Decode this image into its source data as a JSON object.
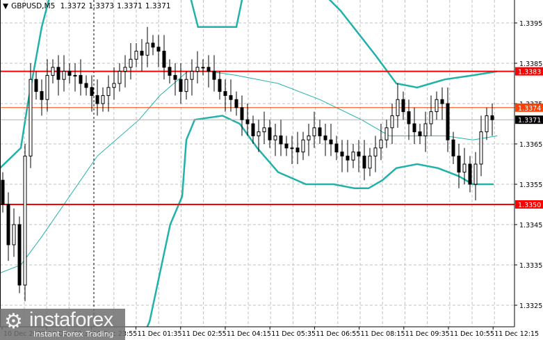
{
  "header": {
    "symbol": "GBPUSD,M5",
    "open": "1.3372",
    "high": "1.3373",
    "low": "1.3371",
    "close": "1.3371",
    "menu_icon": "triangle-down-icon"
  },
  "logo": {
    "brand": "instaforex",
    "tagline": "Instant Forex Trading"
  },
  "colors": {
    "level": "#ff0000",
    "bid": "#ff4000",
    "current": "#000000",
    "band": "#20b2aa",
    "grid": "#c0c0c0"
  },
  "chart_data": {
    "type": "candlestick",
    "title": "GBPUSD,M5",
    "ylim": [
      1.33164,
      1.33957
    ],
    "y_ticks": [
      "1.3395",
      "1.3385",
      "1.3375",
      "1.3365",
      "1.3355",
      "1.3345",
      "1.3335",
      "1.3325"
    ],
    "x_ticks": [
      "10 Dec 2025",
      "10 Dec 22:35",
      "10 Dec 23:55",
      "11 Dec 01:35",
      "11 Dec 02:55",
      "11 Dec 04:15",
      "11 Dec 05:35",
      "11 Dec 06:55",
      "11 Dec 08:15",
      "11 Dec 09:35",
      "11 Dec 10:55",
      "11 Dec 12:15"
    ],
    "closes": [
      1.335,
      1.334,
      1.3345,
      1.333,
      1.3362,
      1.3381,
      1.3378,
      1.3376,
      1.3382,
      1.3384,
      1.3381,
      1.3383,
      1.3382,
      1.3382,
      1.338,
      1.3379,
      1.3377,
      1.3375,
      1.3377,
      1.3379,
      1.338,
      1.3383,
      1.3384,
      1.3386,
      1.3388,
      1.3387,
      1.339,
      1.3389,
      1.3388,
      1.3384,
      1.3382,
      1.3381,
      1.3378,
      1.3381,
      1.3383,
      1.3384,
      1.3384,
      1.3383,
      1.3381,
      1.3378,
      1.3377,
      1.3376,
      1.3374,
      1.3371,
      1.337,
      1.3367,
      1.3368,
      1.3369,
      1.3366,
      1.3367,
      1.3365,
      1.3364,
      1.3364,
      1.3363,
      1.3366,
      1.3367,
      1.3369,
      1.3367,
      1.3366,
      1.3365,
      1.3363,
      1.3362,
      1.3361,
      1.3363,
      1.3362,
      1.3359,
      1.3362,
      1.3364,
      1.3366,
      1.3369,
      1.3372,
      1.3376,
      1.3373,
      1.337,
      1.3368,
      1.3367,
      1.337,
      1.3373,
      1.3376,
      1.3375,
      1.3366,
      1.3362,
      1.3358,
      1.336,
      1.3355,
      1.336,
      1.3368,
      1.3372,
      1.3371
    ],
    "bollinger": {
      "upper": [
        [
          [
            -0.5,
            1.3359
          ],
          [
            3.25,
            1.3364
          ],
          [
            4.5,
            1.3375
          ],
          [
            7,
            1.3394
          ],
          [
            8.9,
            1.3404
          ]
        ],
        [
          [
            33.25,
            1.3404
          ],
          [
            35.1,
            1.3394
          ],
          [
            42,
            1.3394
          ],
          [
            43.5,
            1.3404
          ]
        ],
        [
          [
            56.4,
            1.3404
          ],
          [
            60.75,
            1.3398
          ],
          [
            67,
            1.3387
          ],
          [
            70.75,
            1.338
          ],
          [
            74.5,
            1.3379
          ],
          [
            77,
            1.338
          ],
          [
            79.5,
            1.3381
          ],
          [
            84.5,
            1.3382
          ],
          [
            88.9,
            1.3383
          ]
        ]
      ],
      "middle": [
        [
          -0.5,
          1.3333
        ],
        [
          3.25,
          1.3335
        ],
        [
          7,
          1.3342
        ],
        [
          12,
          1.3352
        ],
        [
          17,
          1.3362
        ],
        [
          24.5,
          1.3371
        ],
        [
          28.25,
          1.3377
        ],
        [
          33.25,
          1.3383
        ],
        [
          37,
          1.3383
        ],
        [
          42,
          1.3382
        ],
        [
          49.5,
          1.338
        ],
        [
          57,
          1.3376
        ],
        [
          64.5,
          1.3371
        ],
        [
          69.5,
          1.3367
        ],
        [
          74.5,
          1.3367
        ],
        [
          79.5,
          1.3367
        ],
        [
          84.5,
          1.3366
        ],
        [
          88.9,
          1.3367
        ]
      ],
      "lower": [
        [
          24.5,
          1.3315
        ],
        [
          26.4,
          1.3321
        ],
        [
          30.1,
          1.3345
        ],
        [
          32.25,
          1.3352
        ],
        [
          33,
          1.3366
        ],
        [
          34.5,
          1.3371
        ],
        [
          39.5,
          1.3372
        ],
        [
          42.6,
          1.337
        ],
        [
          45.75,
          1.3364
        ],
        [
          49.5,
          1.3358
        ],
        [
          54.5,
          1.3355
        ],
        [
          59.5,
          1.3355
        ],
        [
          63.25,
          1.3354
        ],
        [
          65.75,
          1.3354
        ],
        [
          68.25,
          1.3356
        ],
        [
          70.75,
          1.3359
        ],
        [
          74.5,
          1.336
        ],
        [
          78.25,
          1.3359
        ],
        [
          82,
          1.3357
        ],
        [
          84.5,
          1.3355
        ],
        [
          88.25,
          1.3355
        ]
      ]
    },
    "levels": [
      {
        "name": "resistance",
        "price": 1.3383,
        "label": "1.3383",
        "kind": "level"
      },
      {
        "name": "bid",
        "price": 1.3374,
        "label": "1.3374",
        "kind": "bid"
      },
      {
        "name": "current",
        "price": 1.3371,
        "label": "1.3371",
        "kind": "current"
      },
      {
        "name": "support",
        "price": 1.335,
        "label": "1.3350",
        "kind": "level"
      }
    ]
  }
}
